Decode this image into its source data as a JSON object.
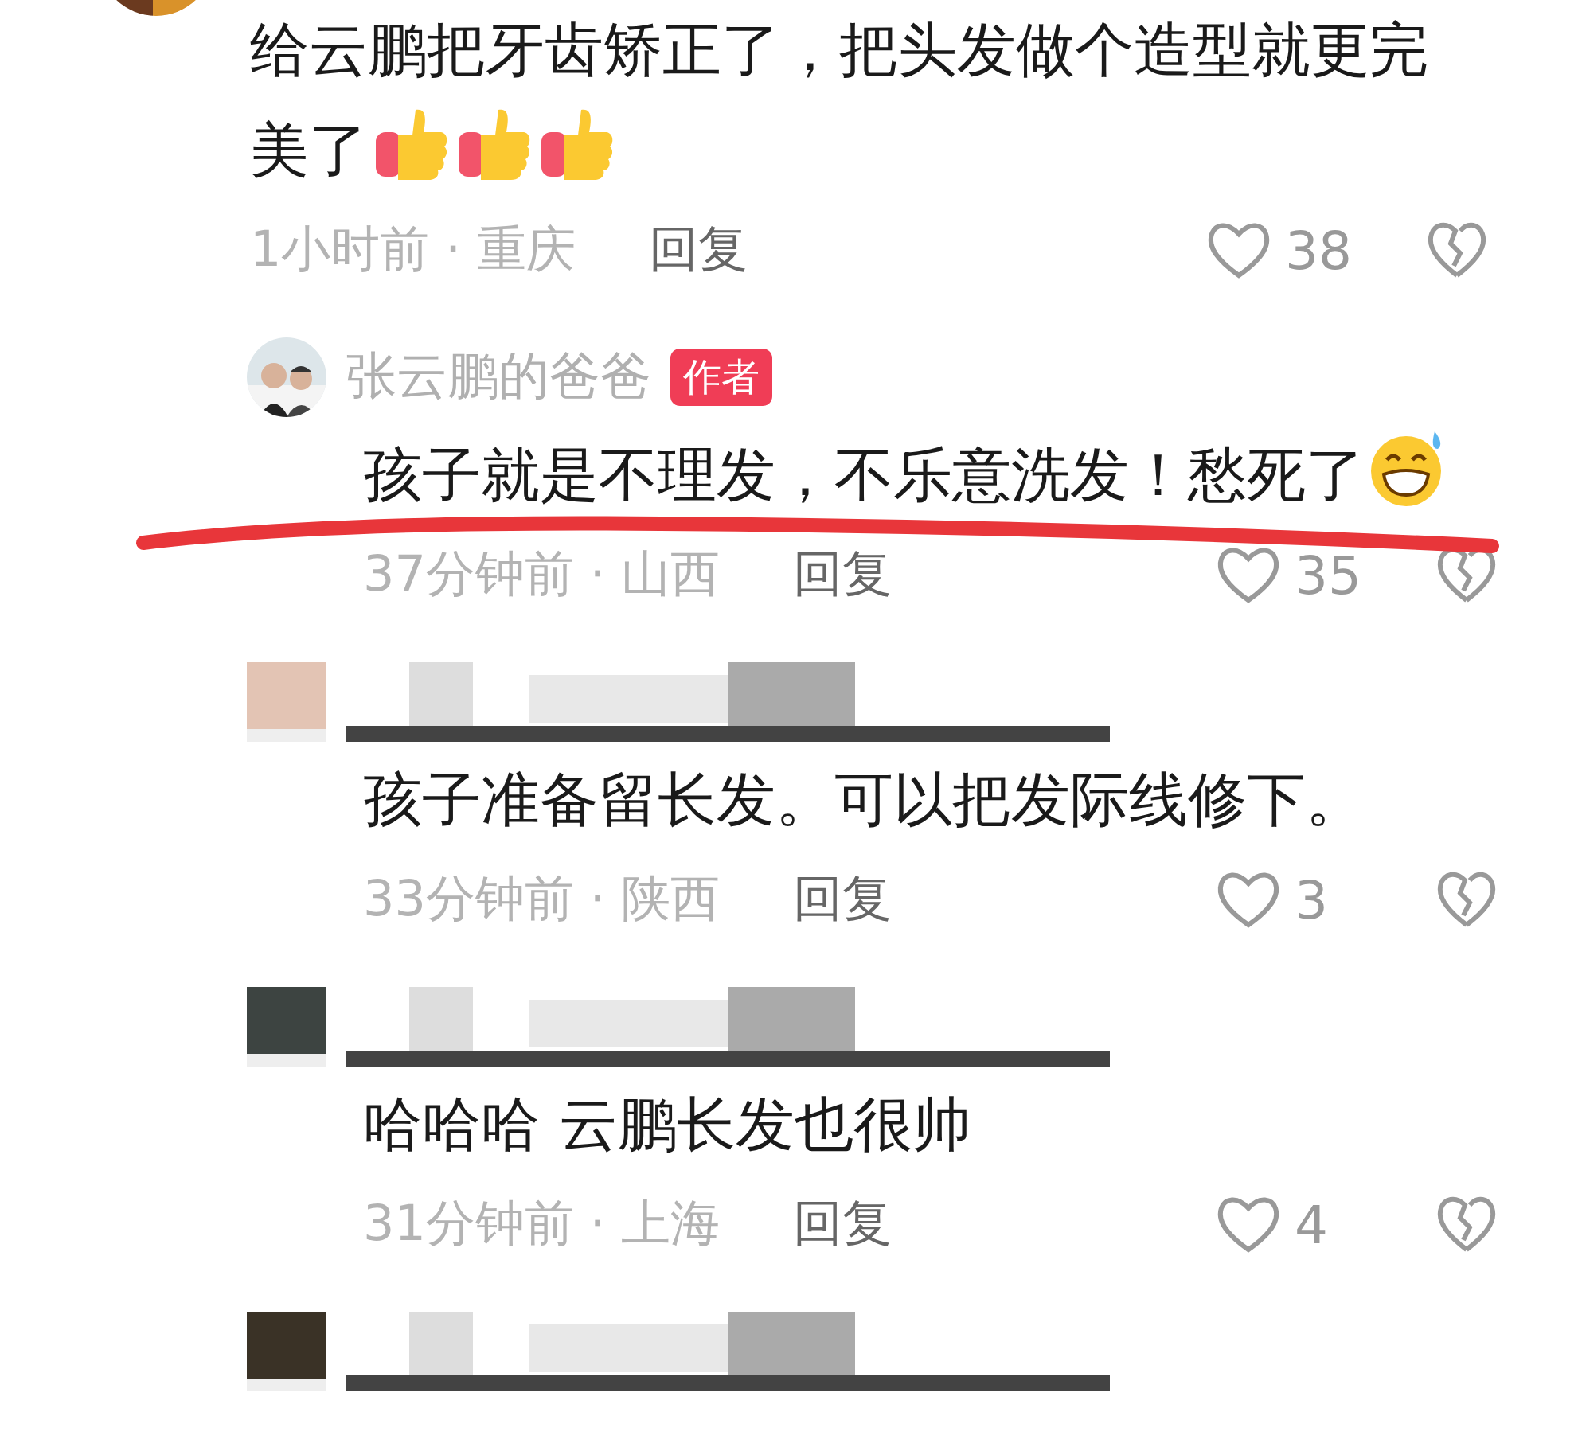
{
  "comment": {
    "text": "给云鹏把牙齿矫正了，把头发做个造型就更完美了",
    "emojis": [
      {
        "kind": "thumbs_up"
      },
      {
        "kind": "thumbs_up"
      },
      {
        "kind": "thumbs_up"
      }
    ],
    "time": "1小时前",
    "separator": "·",
    "location": "重庆",
    "reply_label": "回复",
    "likes": "38",
    "children": [
      {
        "name": "张云鹏的爸爸",
        "badge": "作者",
        "text": "孩子就是不理发，不乐意洗发！愁死了",
        "emojis": [
          {
            "kind": "sweat_grin"
          }
        ],
        "time": "37分钟前",
        "separator": "·",
        "location": "山西",
        "reply_label": "回复",
        "likes": "35",
        "marked": true
      },
      {
        "name_censored": true,
        "text": "孩子准备留长发。可以把发际线修下。",
        "time": "33分钟前",
        "separator": "·",
        "location": "陕西",
        "reply_label": "回复",
        "likes": "3"
      },
      {
        "name_censored": true,
        "text": "哈哈哈 云鹏长发也很帅",
        "time": "31分钟前",
        "separator": "·",
        "location": "上海",
        "reply_label": "回复",
        "likes": "4"
      },
      {
        "name_censored": true
      }
    ]
  }
}
